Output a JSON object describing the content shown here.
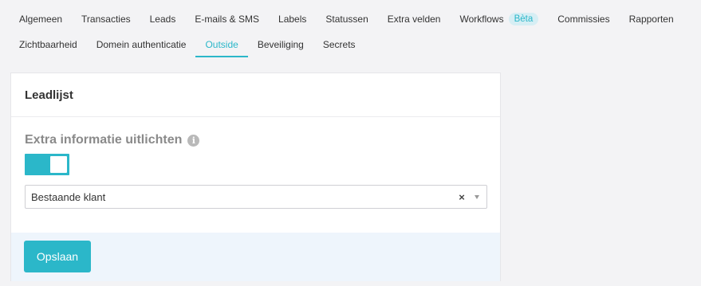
{
  "tabs": {
    "row1": [
      {
        "label": "Algemeen"
      },
      {
        "label": "Transacties"
      },
      {
        "label": "Leads"
      },
      {
        "label": "E-mails & SMS"
      },
      {
        "label": "Labels"
      },
      {
        "label": "Statussen"
      },
      {
        "label": "Extra velden"
      },
      {
        "label": "Workflows",
        "badge": "Bèta"
      },
      {
        "label": "Commissies"
      },
      {
        "label": "Rapporten"
      }
    ],
    "row2": [
      {
        "label": "Zichtbaarheid"
      },
      {
        "label": "Domein authenticatie"
      },
      {
        "label": "Outside",
        "active": true
      },
      {
        "label": "Beveiliging"
      },
      {
        "label": "Secrets"
      }
    ]
  },
  "card": {
    "title": "Leadlijst",
    "field_label": "Extra informatie uitlichten",
    "info_icon": "i",
    "toggle_on": true,
    "select_value": "Bestaande klant",
    "clear_icon": "×",
    "save_label": "Opslaan"
  },
  "colors": {
    "accent": "#2bb7c9",
    "footer_bg": "#eef5fc",
    "page_bg": "#f3f3f5"
  }
}
